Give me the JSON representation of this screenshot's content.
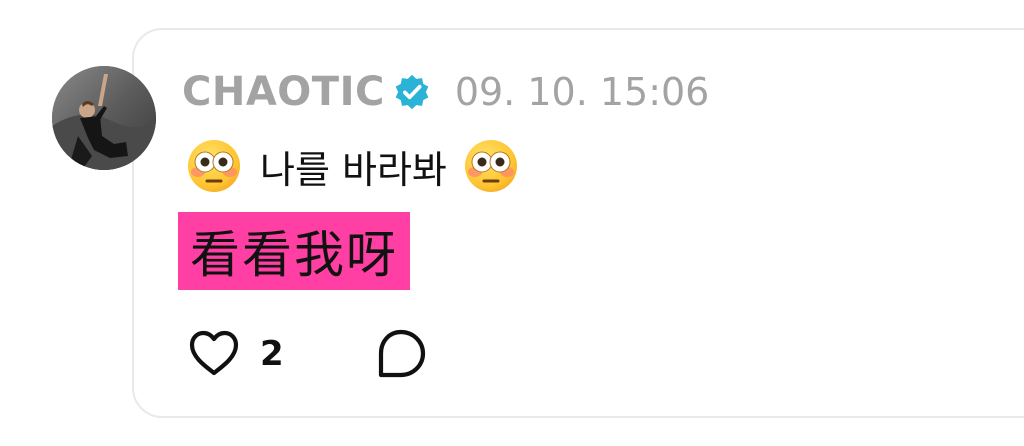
{
  "post": {
    "username": "CHAOTIC",
    "verified": true,
    "timestamp": "09. 10. 15:06",
    "line1_emoji": "flushed-face",
    "line1_text": "나를 바라봐",
    "line2_text": "看看我呀",
    "line2_highlight_color": "#ff3fa4"
  },
  "actions": {
    "like_icon": "heart-icon",
    "like_count": "2",
    "reply_icon": "speech-bubble-icon"
  },
  "colors": {
    "muted_text": "#a3a3a3",
    "verified_badge": "#2ab3d6",
    "card_border": "#e9e9e9"
  }
}
